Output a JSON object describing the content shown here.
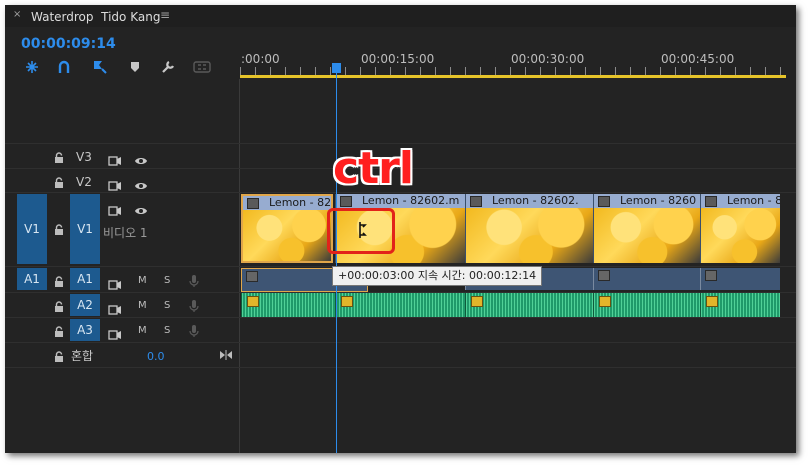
{
  "panel": {
    "close_glyph": "×",
    "title": "Waterdrop  Tido Kang",
    "menu_glyph": "≡",
    "timecode": "00:00:09:14"
  },
  "toolbar": {
    "tools": [
      "snap-icon",
      "linked-selection-icon",
      "add-marker-icon",
      "marker-icon",
      "wrench-icon",
      "captions-icon"
    ]
  },
  "ruler": {
    "labels": [
      ":00:00",
      "00:00:15:00",
      "00:00:30:00",
      "00:00:45:00"
    ]
  },
  "tracks": {
    "v3": {
      "label": "V3"
    },
    "v2": {
      "label": "V2"
    },
    "v1": {
      "source": "V1",
      "label": "V1",
      "name": "비디오 1"
    },
    "a1": {
      "source": "A1",
      "label": "A1",
      "m": "M",
      "s": "S"
    },
    "a2": {
      "label": "A2",
      "m": "M",
      "s": "S"
    },
    "a3": {
      "label": "A3",
      "m": "M",
      "s": "S"
    },
    "mix": {
      "label": "혼합",
      "value": "0.0"
    }
  },
  "clips": {
    "video": [
      "Lemon - 82",
      "Lemon - 82602.m",
      "Lemon - 82602.",
      "Lemon - 8260",
      "Lemon - 8"
    ]
  },
  "overlay": {
    "annotation": "ctrl",
    "tooltip": "+00:00:03:00 지속 시간: 00:00:12:14"
  },
  "colors": {
    "accent": "#2d8ceb",
    "annotation": "#ff1f1f",
    "video_clip": "#8fa6c7",
    "audio_clip": "#1f9a6a"
  }
}
